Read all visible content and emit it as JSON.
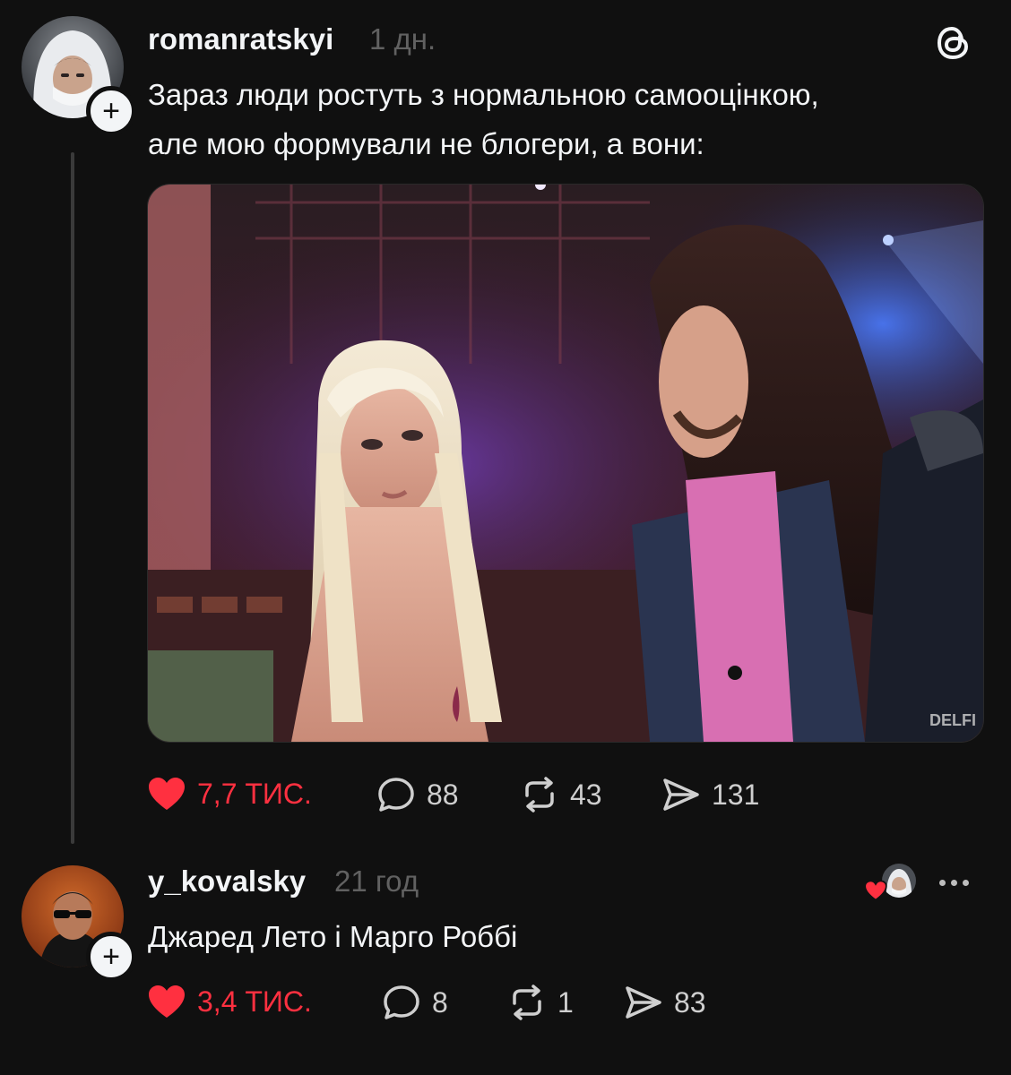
{
  "post": {
    "username": "romanratskyi",
    "time": "1 дн.",
    "text_line1": "Зараз люди ростуть з нормальною самооцінкою,",
    "text_line2": "але мою формували не блогери, а вони:",
    "image_watermark": "DELFI",
    "actions": {
      "likes": "7,7 ТИС.",
      "replies": "88",
      "reposts": "43",
      "shares": "131"
    },
    "icons": {
      "threads_logo": "threads-logo-icon",
      "follow": "plus-icon"
    }
  },
  "reply": {
    "username": "y_kovalsky",
    "time": "21 год",
    "text": "Джаред Лето і Марго Роббі",
    "actions": {
      "likes": "3,4 ТИС.",
      "replies": "8",
      "reposts": "1",
      "shares": "83"
    }
  },
  "colors": {
    "background": "#101010",
    "text": "#f3f5f7",
    "muted": "#616161",
    "like": "#ff3040"
  }
}
